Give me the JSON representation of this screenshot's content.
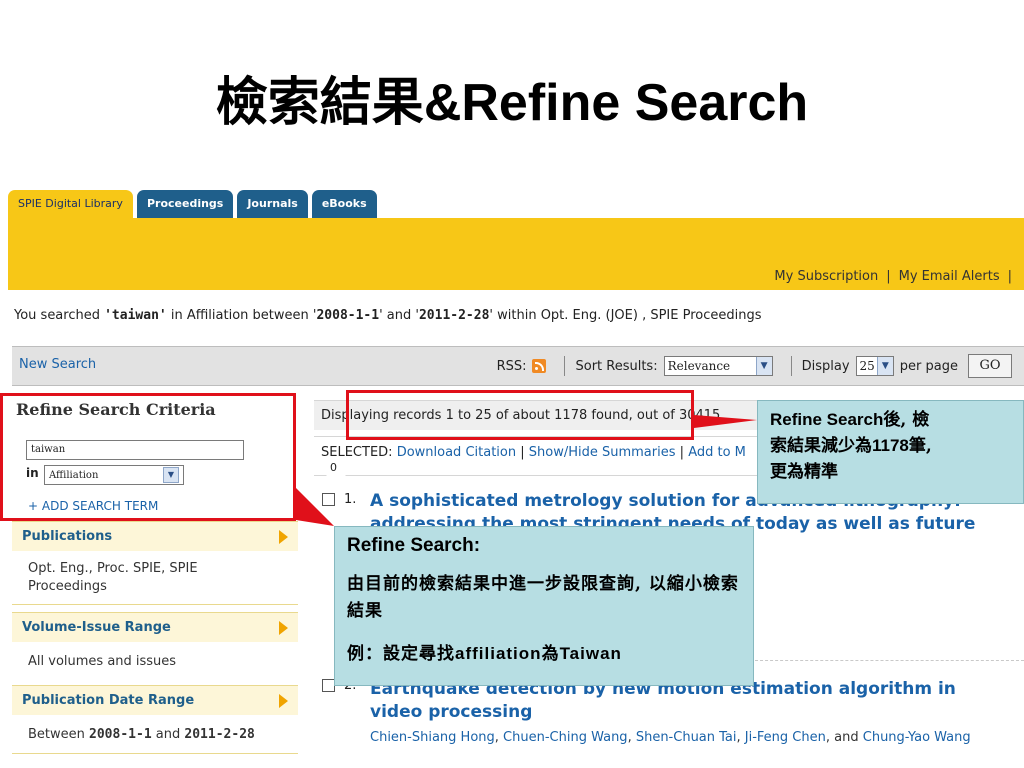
{
  "slide": {
    "title_zh": "檢索結果",
    "title_en": "&Refine Search"
  },
  "tabs": [
    "SPIE Digital Library",
    "Proceedings",
    "Journals",
    "eBooks"
  ],
  "banner": {
    "my_subscription": "My Subscription",
    "my_email_alerts": "My Email Alerts",
    "separator": "|"
  },
  "search_summary": {
    "prefix": "You searched ",
    "term": "'taiwan'",
    "in_text": " in Affiliation between '",
    "date_from": "2008-1-1",
    "and_text": "' and '",
    "date_to": "2011-2-28",
    "suffix": "' within Opt. Eng. (JOE) , SPIE Proceedings"
  },
  "toolbar": {
    "new_search": "New Search",
    "rss_label": "RSS:",
    "sort_label": "Sort Results:",
    "sort_value": "Relevance",
    "display_label": "Display",
    "display_value": "25",
    "per_page": "per page",
    "go": "GO"
  },
  "refine": {
    "title": "Refine Search Criteria",
    "term_value": "taiwan",
    "in_label": "in",
    "field_value": "Affiliation",
    "add_term": "+ ADD SEARCH TERM",
    "publications_head": "Publications",
    "publications_value": "Opt. Eng., Proc. SPIE, SPIE Proceedings",
    "volume_head": "Volume-Issue Range",
    "volume_value": "All volumes and issues",
    "date_head": "Publication Date Range",
    "date_between": "Between",
    "date_from": "2008-1-1",
    "date_and": "and",
    "date_to": "2011-2-28"
  },
  "results": {
    "displaying": "Displaying records 1 to 25 of about 1178 found, out of 30415",
    "selected_label": "SELECTED:",
    "download_citation": "Download Citation",
    "show_hide": "Show/Hide Summaries",
    "add_to": "Add to M",
    "pipe": "|",
    "selected_count": "0",
    "items": [
      {
        "num": "1.",
        "title": "A sophisticated metrology solution for advanced lithography: addressing the most stringent needs of today as well as future"
      },
      {
        "num": "2.",
        "title": "Earthquake detection by new motion estimation algorithm in video processing",
        "authors": [
          "Chien-Shiang Hong",
          "Chuen-Ching Wang",
          "Shen-Chuan Tai",
          "Ji-Feng Chen",
          "Chung-Yao Wang"
        ],
        "and_text": "and"
      }
    ]
  },
  "callouts": {
    "c1_en": "Refine Search",
    "c1_zh_a": "後, 檢",
    "c1_zh_b": "索結果減少為",
    "c1_num": "1178",
    "c1_zh_c": "筆,",
    "c1_zh_d": "更為精準",
    "c2_head": "Refine Search:",
    "c2_body": "由目前的檢索結果中進一步設限查詢, 以縮小檢索結果",
    "c2_ex_zh": "例：設定尋找",
    "c2_ex_en1": "affiliation",
    "c2_ex_zh2": "為",
    "c2_ex_en2": "Taiwan"
  },
  "colors": {
    "banner_yellow": "#f7c717",
    "tab_blue": "#1f5f8b",
    "link_blue": "#1a62a8",
    "annotation_red": "#e0101a",
    "callout_teal": "#b7dee3"
  }
}
